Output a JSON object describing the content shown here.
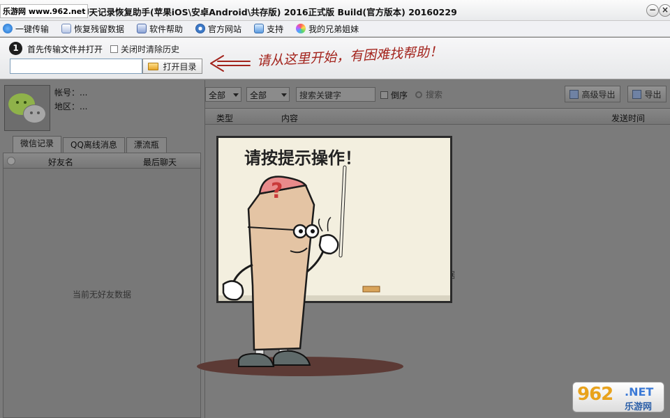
{
  "titlebar": {
    "watermark": "乐游网 www.962.net",
    "title": "微信聊天记录恢复助手(苹果iOS\\安卓Android\\共存版) 2016正式版  Build(官方版本) 20160229",
    "minimize": "−",
    "close": "×"
  },
  "menu": {
    "items": [
      {
        "label": "一键传输",
        "icon": "transfer-icon"
      },
      {
        "label": "恢复残留数据",
        "icon": "restore-icon"
      },
      {
        "label": "软件帮助",
        "icon": "help-icon"
      },
      {
        "label": "官方网站",
        "icon": "website-icon"
      },
      {
        "label": "支持",
        "icon": "support-icon"
      },
      {
        "label": "我的兄弟姐妹",
        "icon": "siblings-icon"
      }
    ]
  },
  "step": {
    "number": "1",
    "label": "首先传输文件并打开",
    "clear_history_label": "关闭时清除历史",
    "path_value": "",
    "open_dir_label": "打开目录",
    "hint": "请从这里开始，有困难找帮助！"
  },
  "profile": {
    "account_label": "帐号：...",
    "region_label": "地区：..."
  },
  "tabs": [
    {
      "label": "微信记录",
      "active": true
    },
    {
      "label": "QQ离线消息",
      "active": false
    },
    {
      "label": "漂流瓶",
      "active": false
    }
  ],
  "friends": {
    "col_name": "好友名",
    "col_last_chat": "最后聊天",
    "empty_text": "当前无好友数据"
  },
  "filters": {
    "type_select": "全部",
    "range_select": "全部",
    "keyword_placeholder": "搜索关键字",
    "reverse_label": "倒序",
    "search_label": "搜索",
    "advanced_export_label": "高级导出",
    "export_label": "导出"
  },
  "messages": {
    "col_type": "类型",
    "col_content": "内容",
    "col_time": "发送时间",
    "empty_text": "据"
  },
  "overlay": {
    "board_text": "请按提示操作！",
    "hat_mark": "?"
  },
  "watermark_logo": {
    "number": "962",
    "net": ".NET",
    "cn": "乐游网"
  },
  "colors": {
    "hint_red": "#a3231c",
    "dim_overlay": "#7b7b7b",
    "board_paper": "#f3efdf"
  }
}
